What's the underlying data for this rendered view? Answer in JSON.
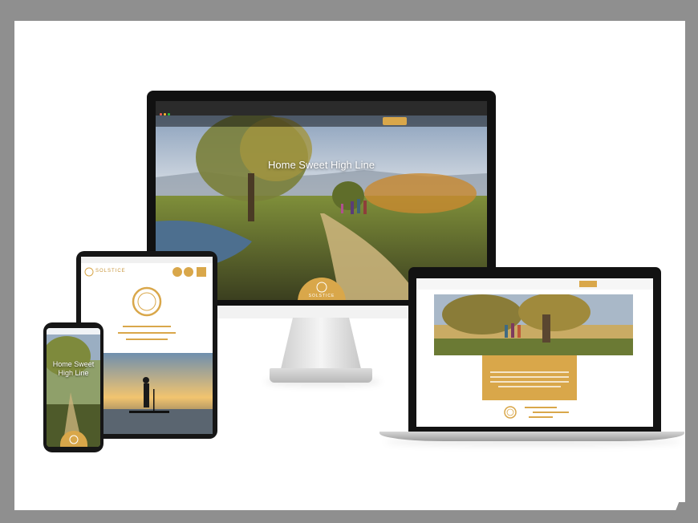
{
  "scene": "responsive device mockup",
  "colors": {
    "brand_gold": "#d9a74a",
    "frame_gray": "#8f8f8f"
  },
  "monitor": {
    "hero_title": "Home Sweet High Line",
    "badge_text": "SOLSTICE"
  },
  "tablet": {
    "brand": "SOLSTICE"
  },
  "phone": {
    "hero_title_line1": "Home Sweet",
    "hero_title_line2": "High Line"
  },
  "icons": [
    "monitor-device",
    "laptop-device",
    "tablet-device",
    "phone-device",
    "sun-logo-icon"
  ]
}
